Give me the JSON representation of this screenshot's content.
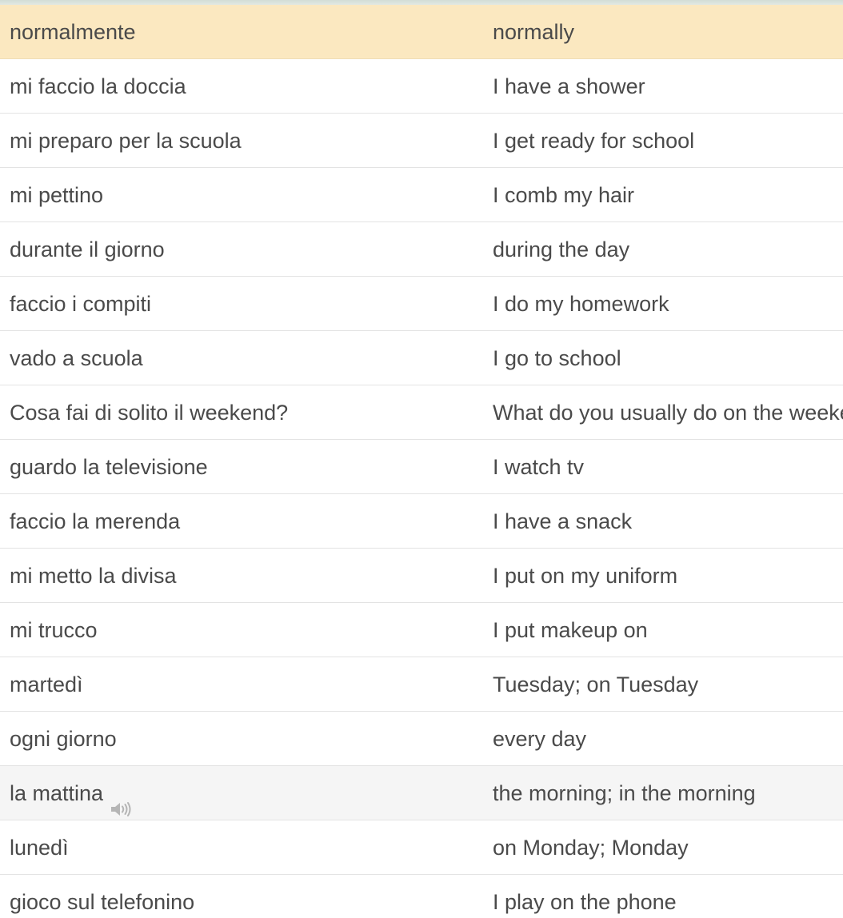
{
  "vocabulary": {
    "rows": [
      {
        "term": "normalmente",
        "definition": "normally"
      },
      {
        "term": "mi faccio la doccia",
        "definition": "I have a shower"
      },
      {
        "term": "mi preparo per la scuola",
        "definition": "I get ready for school"
      },
      {
        "term": "mi pettino",
        "definition": "I comb my hair"
      },
      {
        "term": "durante il giorno",
        "definition": "during the day"
      },
      {
        "term": "faccio i compiti",
        "definition": "I do my homework"
      },
      {
        "term": "vado a scuola",
        "definition": "I go to school"
      },
      {
        "term": "Cosa fai di solito il weekend?",
        "definition": "What do you usually do on the weekend?"
      },
      {
        "term": "guardo la televisione",
        "definition": "I watch tv"
      },
      {
        "term": "faccio la merenda",
        "definition": "I have a snack"
      },
      {
        "term": "mi metto la divisa",
        "definition": "I put on my uniform"
      },
      {
        "term": "mi trucco",
        "definition": "I put makeup on"
      },
      {
        "term": "martedì",
        "definition": "Tuesday; on Tuesday"
      },
      {
        "term": "ogni giorno",
        "definition": "every day"
      },
      {
        "term": "la mattina",
        "definition": "the morning; in the morning"
      },
      {
        "term": "lunedì",
        "definition": "on Monday; Monday"
      },
      {
        "term": "gioco sul telefonino",
        "definition": "I play on the phone"
      }
    ]
  },
  "colors": {
    "highlight_row": "#fbe8c0",
    "hover_row": "#f5f5f5",
    "text": "#4a4a4a",
    "divider": "#e3e3e3"
  },
  "icons": {
    "audio": "speaker-icon"
  }
}
